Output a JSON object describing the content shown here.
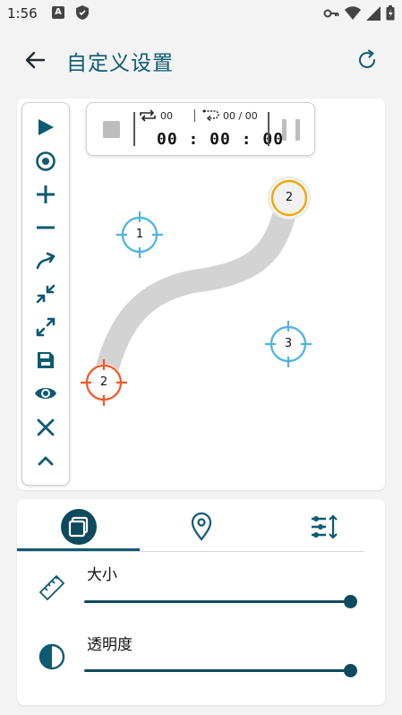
{
  "status": {
    "time": "1:56",
    "a_badge": "A"
  },
  "appbar": {
    "title": "自定义设置"
  },
  "timer": {
    "loop_count": "00",
    "repeat_count": "00 / 00",
    "time": "00 : 00 : 00"
  },
  "markers": [
    {
      "label": "1",
      "color": "#4fb3e0"
    },
    {
      "label": "2",
      "color": "#f0a800"
    },
    {
      "label": "3",
      "color": "#4fb3e0"
    },
    {
      "label": "2",
      "color": "#f05a2a"
    }
  ],
  "toolbar_icons": [
    "play-icon",
    "target-icon",
    "plus-icon",
    "minus-icon",
    "swipe-icon",
    "collapse-icon",
    "expand-icon",
    "save-icon",
    "eye-icon",
    "close-icon",
    "chevron-up-icon"
  ],
  "tabs": [
    "layers-icon",
    "location-pin-icon",
    "sliders-sort-icon"
  ],
  "settings": {
    "size_label": "大小",
    "size_value": 1.0,
    "opacity_label": "透明度",
    "opacity_value": 1.0
  },
  "colors": {
    "accent": "#0e5a72",
    "slider": "#0e4a5e",
    "path": "#d3d3d3"
  }
}
